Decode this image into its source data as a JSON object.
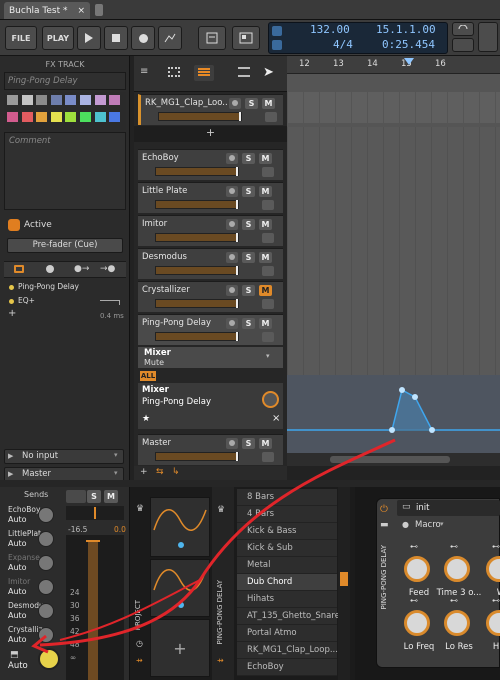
{
  "window": {
    "tab_title": "Buchla Test *",
    "close": "×"
  },
  "toolbar": {
    "file": "FILE",
    "play": "PLAY",
    "tempo": "132.00",
    "signature": "4/4",
    "position": "15.1.1.00",
    "time": "0:25.454"
  },
  "inspector": {
    "title": "FX TRACK",
    "track_name_placeholder": "Ping-Pong Delay",
    "comment_placeholder": "Comment",
    "active_label": "Active",
    "prefader": "Pre-fader (Cue)",
    "devices": [
      {
        "name": "Ping-Pong Delay"
      },
      {
        "name": "EQ+"
      }
    ],
    "latency": "0.4 ms",
    "swatch_colors": [
      "#9a9a9a",
      "#c4c4c4",
      "#8b8b8b",
      "#6e7eac",
      "#7a8cc8",
      "#aab3e2",
      "#c49ad2",
      "#c07cb8",
      "#d25c8e",
      "#e25c60",
      "#e2a23c",
      "#e5e04f",
      "#9ee03d",
      "#4ce05e",
      "#4ec2cf",
      "#4a78e3"
    ],
    "input": "No input",
    "output": "Master"
  },
  "tracks": [
    {
      "name": "RK_MG1_Clap_Loo...",
      "accent": "#d9922c"
    },
    {
      "name": "EchoBoy"
    },
    {
      "name": "Little Plate"
    },
    {
      "name": "Imitor"
    },
    {
      "name": "Desmodus"
    },
    {
      "name": "Crystallizer",
      "m_on": true
    },
    {
      "name": "Ping-Pong Delay",
      "selected": true
    },
    {
      "name": "Master"
    }
  ],
  "automation": {
    "param_title": "Mixer",
    "param_sub": "Mute",
    "all": "ALL",
    "lane_title": "Mixer",
    "lane_sub": "Ping-Pong Delay"
  },
  "ruler": [
    "12",
    "13",
    "14",
    "15",
    "16"
  ],
  "sends": {
    "title": "Sends",
    "items": [
      {
        "name": "EchoBoy",
        "mode": "Auto"
      },
      {
        "name": "LittlePlat",
        "mode": "Auto"
      },
      {
        "name": "Expanse",
        "mode": "Auto"
      },
      {
        "name": "Imitor",
        "mode": "Auto"
      },
      {
        "name": "Desmodu",
        "mode": "Auto"
      },
      {
        "name": "Crystalliz",
        "mode": "Auto"
      }
    ],
    "main_mode": "Auto"
  },
  "meter": {
    "peak": "-16.5",
    "level": "0.0",
    "scale": [
      "24",
      "30",
      "36",
      "42",
      "48",
      "∞"
    ]
  },
  "panels": {
    "project": "PROJECT",
    "pingpong": "PING-PONG DELAY",
    "pingpong2": "PING-PONG DELAY"
  },
  "browser": [
    "8 Bars",
    "4 Bars",
    "Kick & Bass",
    "Kick & Sub",
    "Metal",
    "Dub Chord",
    "Hihats",
    "AT_135_Ghetto_Snare",
    "Portal Atmo",
    "RK_MG1_Clap_Loop...",
    "EchoBoy"
  ],
  "device": {
    "preset": "init",
    "macro": "Macro",
    "knobs": [
      "Feed",
      "Time 3 o...",
      "W",
      "Lo Freq",
      "Lo Res",
      "Hi F"
    ]
  }
}
